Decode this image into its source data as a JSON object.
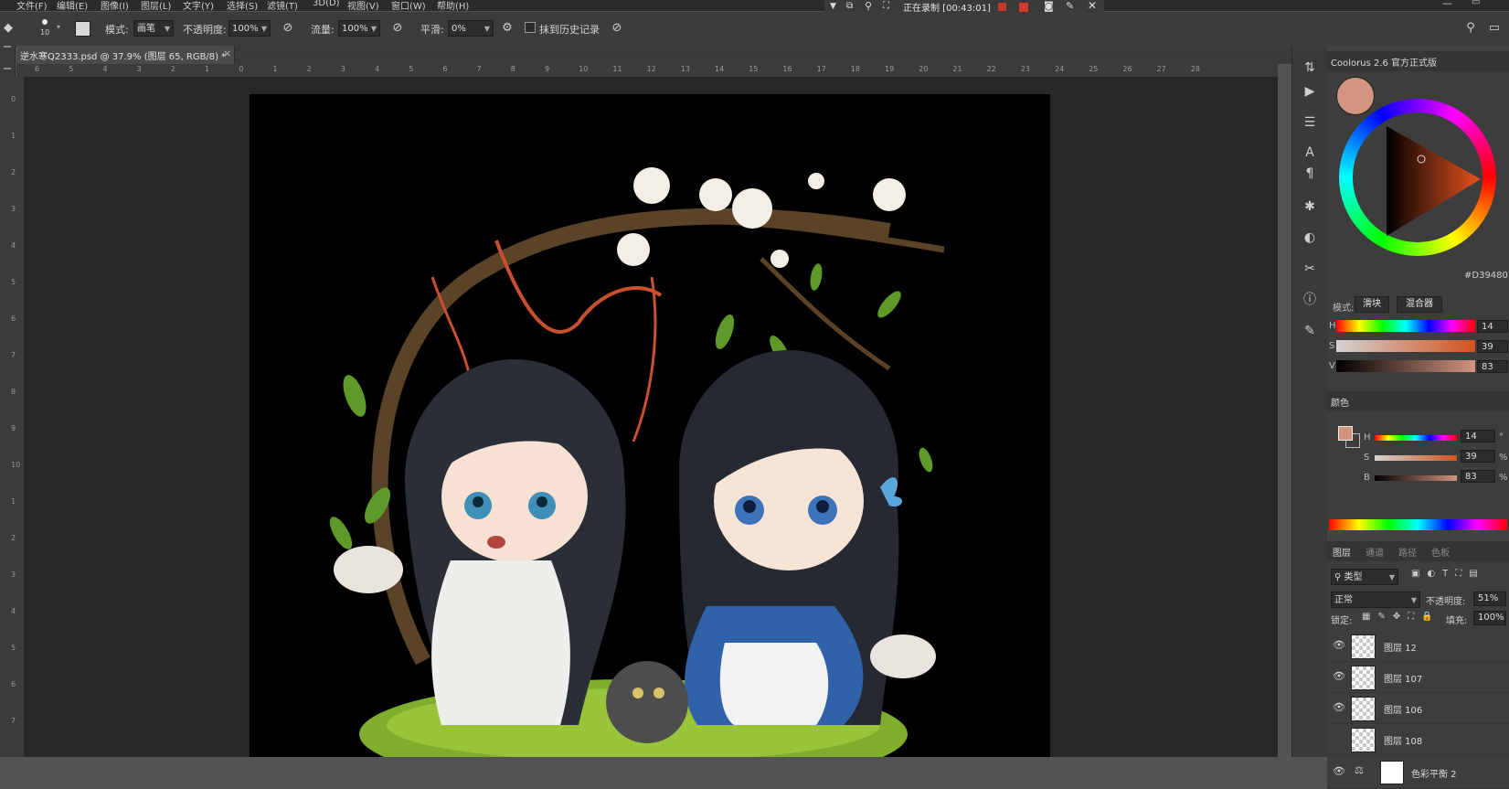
{
  "menu": [
    "文件(F)",
    "编辑(E)",
    "图像(I)",
    "图层(L)",
    "文字(Y)",
    "选择(S)",
    "滤镜(T)",
    "3D(D)",
    "视图(V)",
    "窗口(W)",
    "帮助(H)"
  ],
  "recording": {
    "text": "正在录制 [00:43:01]"
  },
  "options": {
    "brush_size": "10",
    "mode_label": "模式:",
    "mode_value": "画笔",
    "opacity_label": "不透明度:",
    "opacity_value": "100%",
    "flow_label": "流量:",
    "flow_value": "100%",
    "smoothing_label": "平滑:",
    "smoothing_value": "0%",
    "erase_history_label": "抹到历史记录"
  },
  "document": {
    "tab_title": "逆水寒Q2333.psd @ 37.9% (图层 65, RGB/8) *"
  },
  "rulers": {
    "h_ticks": [
      "6",
      "5",
      "4",
      "3",
      "2",
      "1",
      "0",
      "1",
      "2",
      "3",
      "4",
      "5",
      "6",
      "7",
      "8",
      "9",
      "10",
      "11",
      "12",
      "13",
      "14",
      "15",
      "16",
      "17",
      "18",
      "19",
      "20",
      "21",
      "22",
      "23",
      "24",
      "25",
      "26",
      "27",
      "28"
    ],
    "v_ticks": [
      "0",
      "1",
      "2",
      "3",
      "4",
      "5",
      "6",
      "7",
      "8",
      "9",
      "10",
      "1",
      "2",
      "3",
      "4",
      "5",
      "6",
      "7"
    ]
  },
  "coolorus": {
    "title": "Coolorus 2.6 官方正式版",
    "hex": "#D39480",
    "mode_label": "模式:",
    "mode_slider": "滑块",
    "mode_mixer": "混合器",
    "swatch_color": "#d39480",
    "h": {
      "label": "H",
      "value": "14"
    },
    "s": {
      "label": "S",
      "value": "39"
    },
    "v": {
      "label": "V",
      "value": "83"
    }
  },
  "color_panel": {
    "title": "颜色",
    "h": {
      "label": "H",
      "value": "14",
      "unit": "°"
    },
    "s": {
      "label": "S",
      "value": "39",
      "unit": "%"
    },
    "b": {
      "label": "B",
      "value": "83",
      "unit": "%"
    }
  },
  "layers_panel": {
    "tabs": [
      "图层",
      "通道",
      "路径",
      "色板"
    ],
    "filter_label": "类型",
    "blend_mode": "正常",
    "opacity_label": "不透明度:",
    "opacity_value": "51%",
    "lock_label": "锁定:",
    "fill_label": "填充:",
    "fill_value": "100%",
    "layers": [
      {
        "name": "图层 12",
        "visible": true
      },
      {
        "name": "图层 107",
        "visible": true
      },
      {
        "name": "图层 106",
        "visible": true
      },
      {
        "name": "图层 108",
        "visible": false
      },
      {
        "name": "色彩平衡 2",
        "visible": true
      }
    ]
  }
}
